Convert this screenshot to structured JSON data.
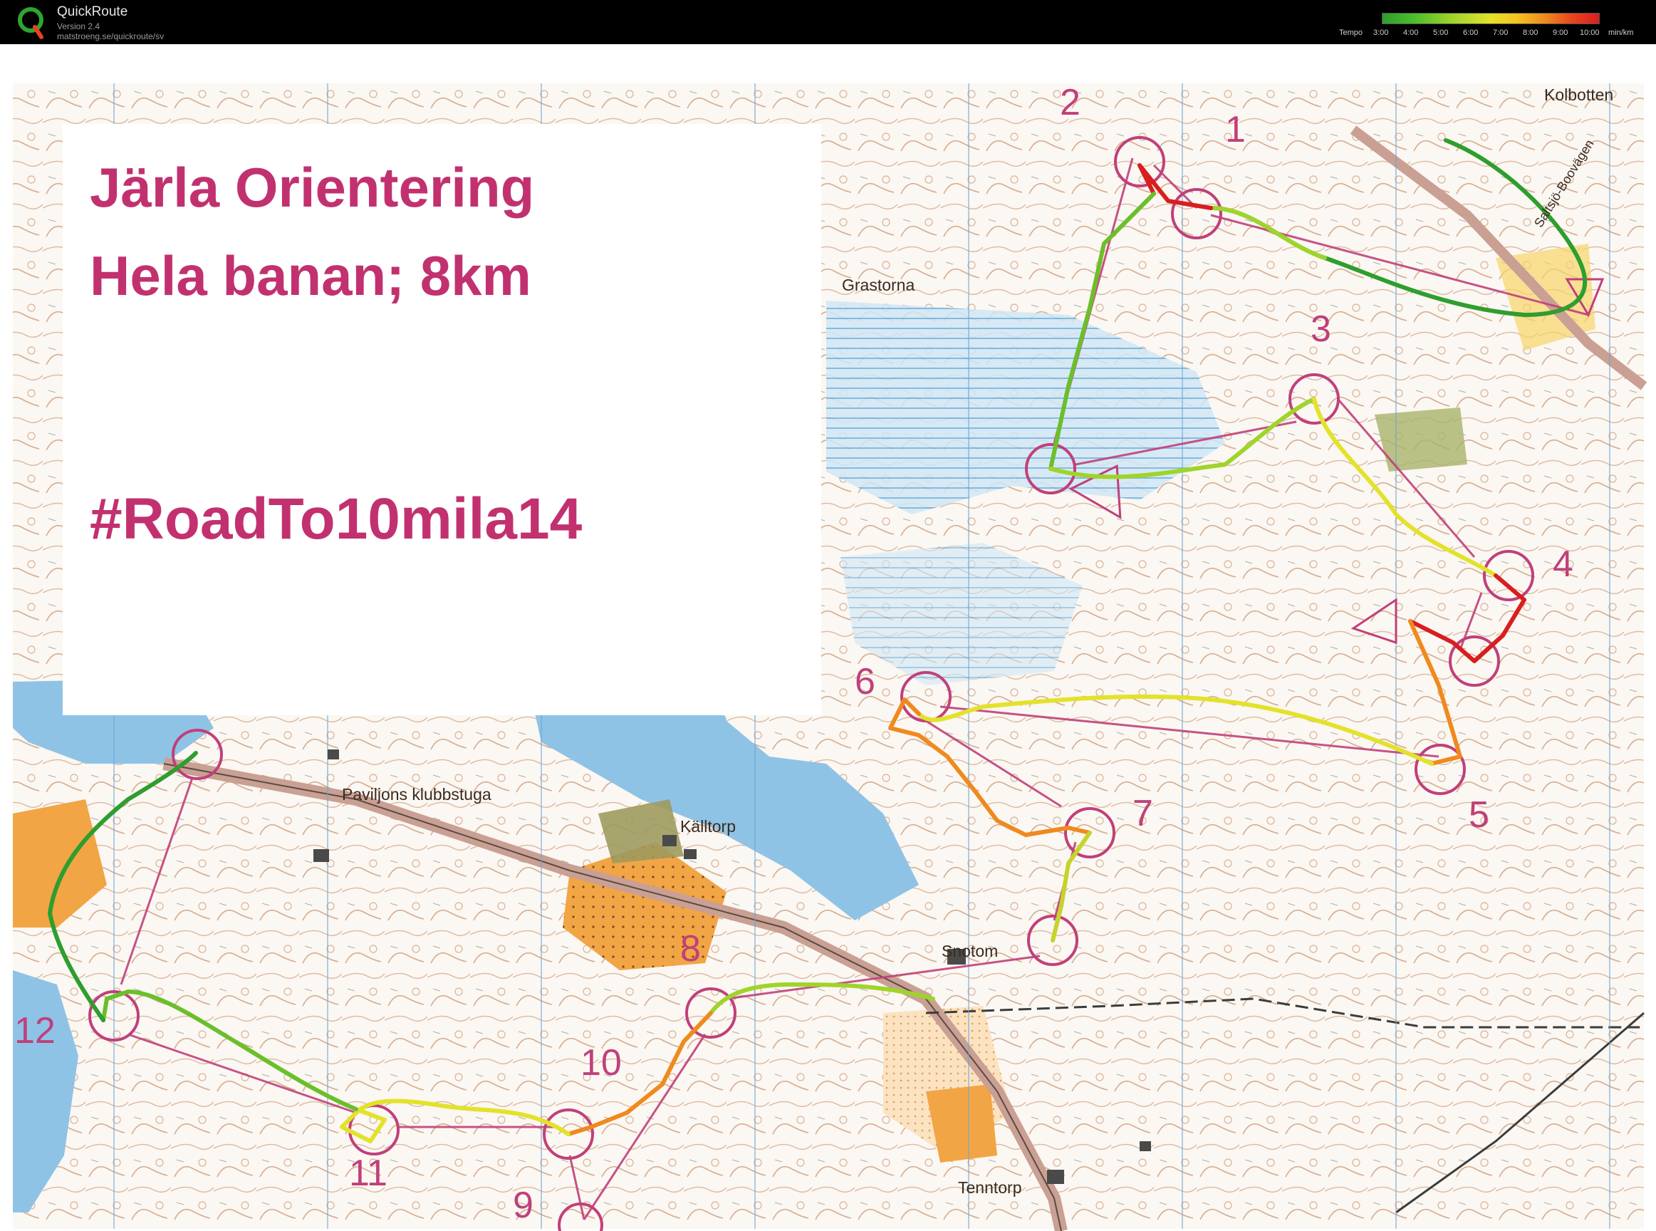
{
  "app": {
    "name": "QuickRoute",
    "version": "Version 2.4",
    "url": "matstroeng.se/quickroute/sv"
  },
  "tempo_legend": {
    "label": "Tempo",
    "ticks": [
      "3:00",
      "4:00",
      "5:00",
      "6:00",
      "7:00",
      "8:00",
      "9:00",
      "10:00"
    ],
    "unit": "min/km",
    "colors": [
      "#2e9e2e",
      "#9fd42a",
      "#e3e22a",
      "#ef8a1e",
      "#d81e1e"
    ]
  },
  "map": {
    "title_lines": [
      "Järla Orientering",
      "Hela banan; 8km",
      "#RoadTo10mila14"
    ],
    "place_names": {
      "kolbotten": "Kolbotten",
      "pavilion": "Paviljons klubbstuga",
      "kalltorp": "Källtorp",
      "snotom": "Snotom",
      "tenntorp": "Tenntorp",
      "saltsjo_road": "Saltsjö-Boovägen",
      "grastorna": "Grastorna"
    },
    "control_numbers": [
      "1",
      "2",
      "3",
      "4",
      "5",
      "6",
      "7",
      "8",
      "9",
      "10",
      "11",
      "12"
    ],
    "colors": {
      "course": "#c0407a",
      "title": "#c2316f",
      "water": "#8fc3e6",
      "field": "#f0a84a",
      "contour": "#b5703f",
      "road": "#c9a093",
      "gps_fast": "#2e9e2e",
      "gps_mid": "#e3e22a",
      "gps_slow": "#d81e1e"
    }
  }
}
